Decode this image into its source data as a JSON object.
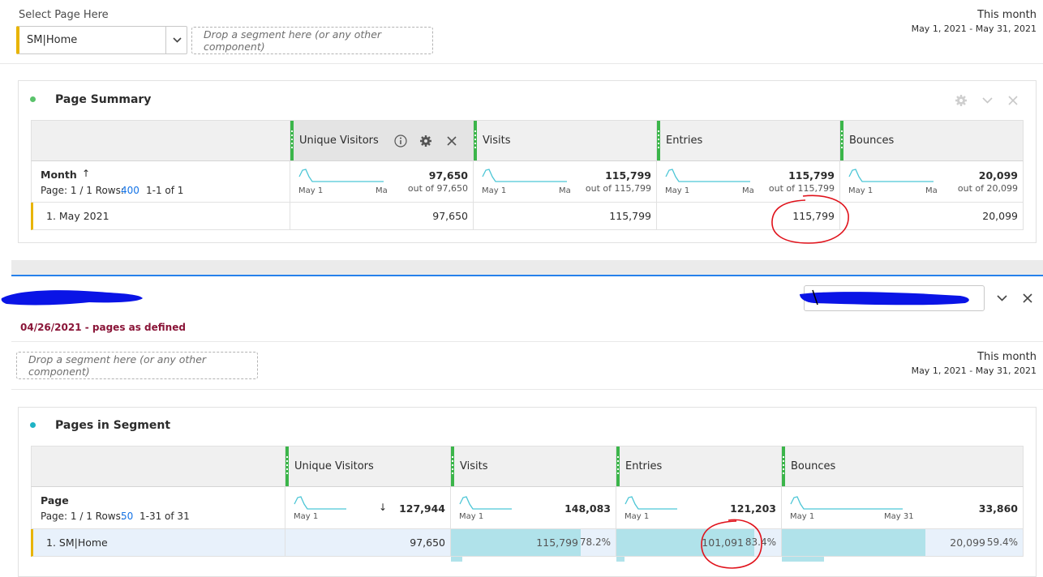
{
  "top": {
    "select_label": "Select Page Here",
    "select_value": "SM|Home",
    "dropzone": "Drop a segment here (or any other component)",
    "date_label": "This month",
    "date_range": "May 1, 2021 - May 31, 2021"
  },
  "summary": {
    "title": "Page Summary",
    "columns": [
      "Unique Visitors",
      "Visits",
      "Entries",
      "Bounces"
    ],
    "dim_name": "Month",
    "page_info": "Page: 1 / 1 Rows:",
    "rows_count": "400",
    "range": "1-1 of 1",
    "totals": [
      "97,650",
      "115,799",
      "115,799",
      "20,099"
    ],
    "outof": [
      "out of 97,650",
      "out of 115,799",
      "out of 115,799",
      "out of 20,099"
    ],
    "spark_start": "May 1",
    "spark_end": "Ma",
    "row_label": "1. May 2021",
    "row_values": [
      "97,650",
      "115,799",
      "115,799",
      "20,099"
    ]
  },
  "section2": {
    "subtitle": "04/26/2021 -  pages as defined",
    "dropzone": "Drop a segment here (or any other component)",
    "date_label": "This month",
    "date_range": "May 1, 2021 - May 31, 2021"
  },
  "segment": {
    "title": "Pages in Segment",
    "columns": [
      "Unique Visitors",
      "Visits",
      "Entries",
      "Bounces"
    ],
    "dim_name": "Page",
    "page_info": "Page: 1 / 1 Rows:",
    "rows_count": "50",
    "range": "1-31 of 31",
    "totals": [
      "127,944",
      "148,083",
      "121,203",
      "33,860"
    ],
    "spark_start": "May 1",
    "spark_end": "May 31",
    "row_label": "1. SM|Home",
    "row_values": [
      "97,650",
      "115,799",
      "101,091",
      "20,099"
    ],
    "row_pcts": [
      "",
      "78.2%",
      "83.4%",
      "59.4%"
    ],
    "bar_fills": [
      0,
      0.782,
      0.834,
      0.594
    ]
  },
  "colors": {
    "accent_green": "#3bb54a",
    "bar_fill": "#b0e2ea",
    "annotation": "#e0121b",
    "redact": "#0a14e6"
  }
}
